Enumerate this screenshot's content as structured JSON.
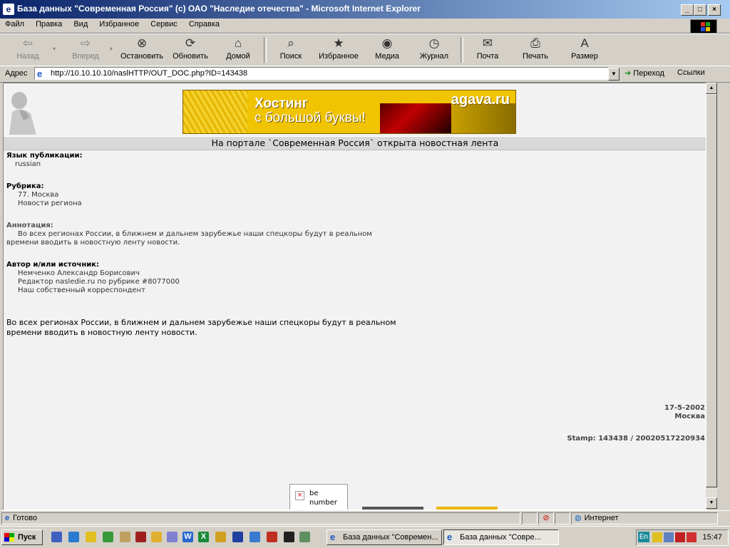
{
  "window": {
    "title": "База данных \"Современная Россия\" (c) ОАО \"Наследие отечества\" - Microsoft Internet Explorer"
  },
  "menu": [
    "Файл",
    "Правка",
    "Вид",
    "Избранное",
    "Сервис",
    "Справка"
  ],
  "toolbar": {
    "back": "Назад",
    "forward": "Вперед",
    "stop": "Остановить",
    "refresh": "Обновить",
    "home": "Домой",
    "search": "Поиск",
    "favorites": "Избранное",
    "media": "Медиа",
    "history": "Журнал",
    "mail": "Почта",
    "print": "Печать",
    "size": "Размер"
  },
  "address": {
    "label": "Адрес",
    "url": "http://10.10.10.10/naslHTTP/OUT_DOC.php?ID=143438",
    "go": "Переход",
    "links": "Ссылки"
  },
  "banner": {
    "line1": "Хостинг",
    "line2": "с большой буквы!",
    "brand": "agava.ru"
  },
  "article": {
    "headline": "На портале `Современная Россия` открыта новостная лента",
    "lang_label": "Язык публикации:",
    "lang_value": "russian",
    "rubric_label": "Рубрика:",
    "rubric_values": [
      "77. Москва",
      "Новости региона"
    ],
    "annotation_label": "Аннотация:",
    "annotation_lines": [
      "Во всех регионах России, в ближнем и дальнем зарубежье наши спецкоры будут в реальном",
      "времени вводить в новостную ленту новости."
    ],
    "author_label": "Автор и/или источник:",
    "author_values": [
      "Немченко Александр Борисович",
      "Редактор nasledie.ru по рубрике #8077000",
      "Наш собственный корреспондент"
    ],
    "body_lines": [
      "Во всех регионах России, в ближнем и дальнем зарубежье наши спецкоры будут в реальном",
      "времени вводить в новостную ленту новости."
    ],
    "date": "17-5-2002",
    "city": "Москва",
    "stamp": "Stamp: 143438 / 20020517220934",
    "broken_image_alt_1": "be",
    "broken_image_alt_2": "number"
  },
  "status": {
    "text": "Готово",
    "zone": "Интернет"
  },
  "taskbar": {
    "start": "Пуск",
    "tasks": [
      "База данных \"Современ...",
      "База данных \"Совре..."
    ],
    "lang": "En",
    "clock": "15:47"
  }
}
